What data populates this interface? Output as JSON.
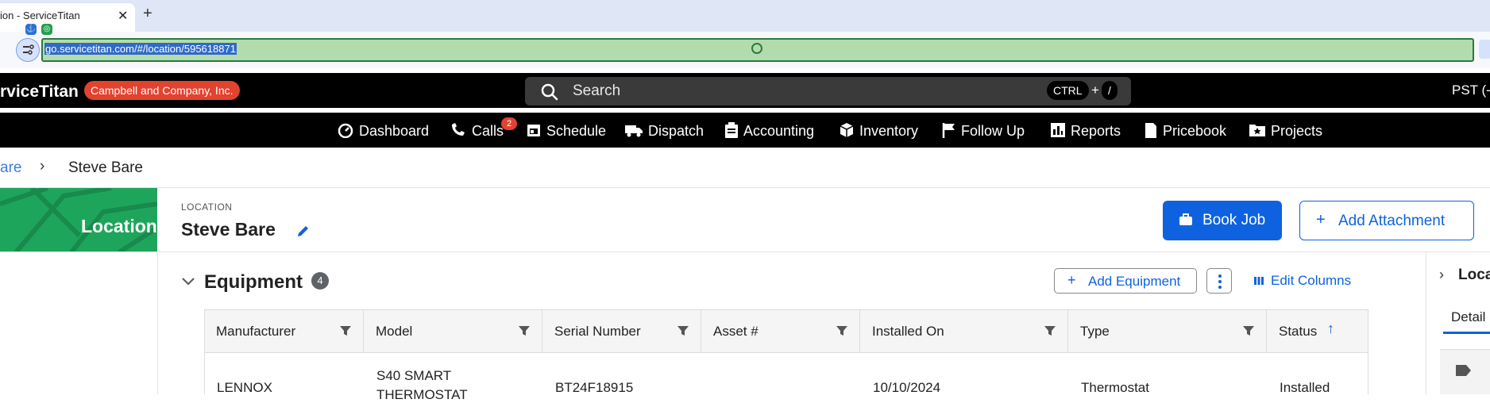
{
  "browser": {
    "tab_title": "ion - ServiceTitan",
    "close_glyph": "✕",
    "new_tab_glyph": "+",
    "url": "go.servicetitan.com/#/location/595618871"
  },
  "header": {
    "logo": "rviceTitan",
    "org_badge": "Campbell and Company, Inc.",
    "search_placeholder": "Search",
    "shortcut_key1": "CTRL",
    "shortcut_plus": "+",
    "shortcut_key2": "/",
    "timezone": "PST (-"
  },
  "nav": {
    "items": [
      {
        "label": "Dashboard",
        "icon": "gauge-icon"
      },
      {
        "label": "Calls",
        "icon": "phone-icon",
        "badge": "2"
      },
      {
        "label": "Schedule",
        "icon": "calendar-icon"
      },
      {
        "label": "Dispatch",
        "icon": "truck-icon"
      },
      {
        "label": "Accounting",
        "icon": "clipboard-icon"
      },
      {
        "label": "Inventory",
        "icon": "box-icon"
      },
      {
        "label": "Follow Up",
        "icon": "flag-icon"
      },
      {
        "label": "Reports",
        "icon": "bar-chart-icon"
      },
      {
        "label": "Pricebook",
        "icon": "book-icon"
      },
      {
        "label": "Projects",
        "icon": "folder-star-icon"
      }
    ]
  },
  "breadcrumb": {
    "previous": "are",
    "separator": "›",
    "current": "Steve Bare"
  },
  "location": {
    "panel_label": "Location",
    "kicker": "LOCATION",
    "name": "Steve Bare",
    "book_job": "Book Job",
    "add_attachment": "Add Attachment",
    "add_glyph": "+"
  },
  "equipment": {
    "title": "Equipment",
    "count": "4",
    "add_label": "Add Equipment",
    "edit_columns": "Edit Columns",
    "columns": [
      "Manufacturer",
      "Model",
      "Serial Number",
      "Asset #",
      "Installed On",
      "Type",
      "Status"
    ],
    "sort_glyph": "↑",
    "rows": [
      {
        "manufacturer": "LENNOX",
        "model_line1": "S40 SMART",
        "model_line2": "THERMOSTAT",
        "serial": "BT24F18915",
        "asset": "",
        "installed_on": "10/10/2024",
        "type": "Thermostat",
        "status": "Installed"
      }
    ]
  },
  "right_panel": {
    "title": "Loca",
    "tab": "Detail",
    "chevron": "›"
  },
  "colors": {
    "brand_green": "#1ea55c",
    "primary_blue": "#0e62e0",
    "badge_red": "#e1432f"
  }
}
